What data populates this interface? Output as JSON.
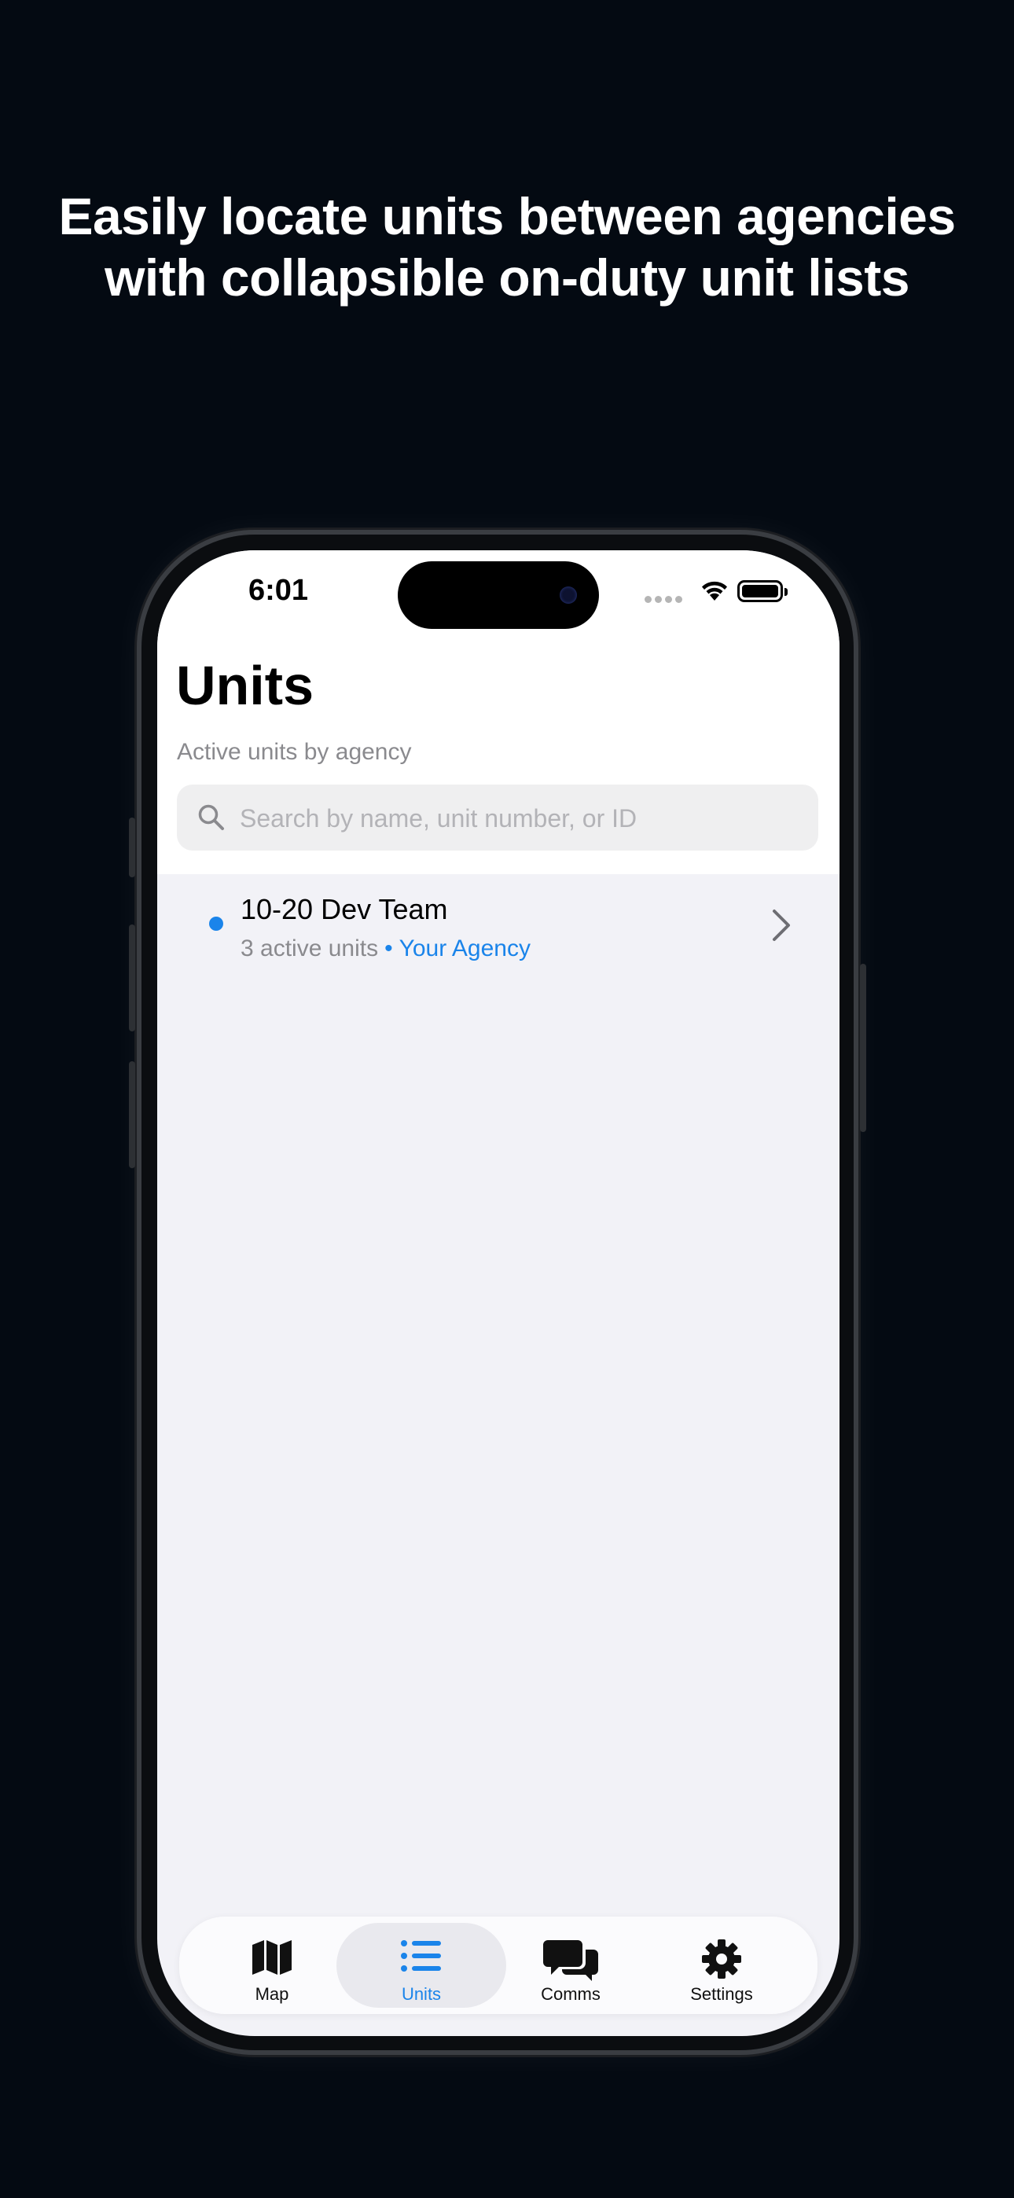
{
  "headline": {
    "line1": "Easily locate units between agencies",
    "line2": "with collapsible on-duty unit lists"
  },
  "status_bar": {
    "time": "6:01",
    "icons": [
      "signal-dots-icon",
      "wifi-icon",
      "battery-icon"
    ]
  },
  "page": {
    "title": "Units",
    "subtitle": "Active units by agency"
  },
  "search": {
    "placeholder": "Search by name, unit number, or ID",
    "value": ""
  },
  "agencies": [
    {
      "name": "10-20 Dev Team",
      "active_units": "3 active units",
      "separator": "•",
      "tag": "Your Agency"
    }
  ],
  "tabs": [
    {
      "label": "Map",
      "icon": "map-icon",
      "active": false
    },
    {
      "label": "Units",
      "icon": "list-icon",
      "active": true
    },
    {
      "label": "Comms",
      "icon": "chat-bubbles-icon",
      "active": false
    },
    {
      "label": "Settings",
      "icon": "gear-icon",
      "active": false
    }
  ],
  "colors": {
    "accent": "#1a84ea",
    "background": "#040a12",
    "list_background": "#f2f2f7"
  }
}
